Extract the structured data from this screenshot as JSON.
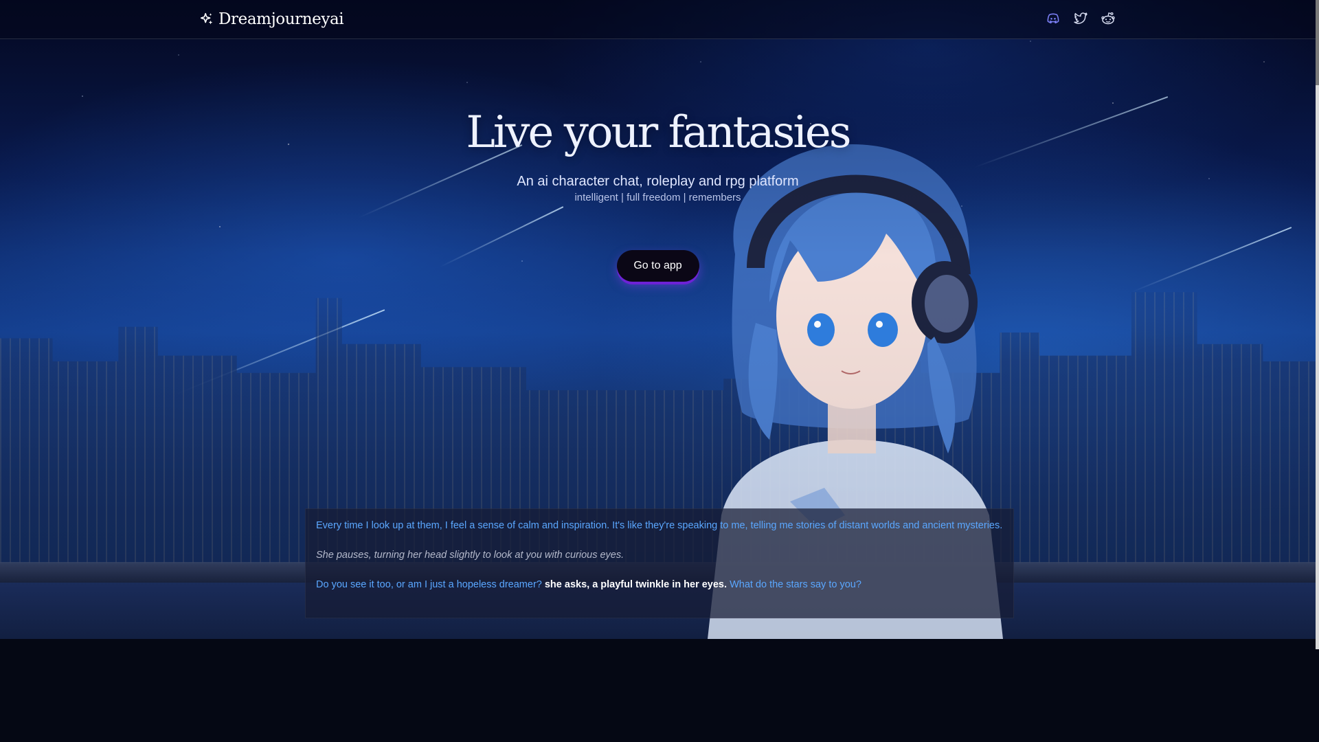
{
  "nav": {
    "brand_name": "Dreamjourneyai",
    "brand_icon": "sparkles-icon",
    "social": [
      {
        "name": "discord-icon",
        "color": "#7b7ff5"
      },
      {
        "name": "twitter-icon",
        "color": "#d6dbef"
      },
      {
        "name": "reddit-icon",
        "color": "#d6dbef"
      }
    ]
  },
  "hero": {
    "headline": "Live your fantasies",
    "subheadline": "An ai character chat, roleplay and rpg platform",
    "tags": "intelligent | full freedom | remembers",
    "cta_label": "Go to app"
  },
  "chat_sample": {
    "line1": "Every time I look up at them, I feel a sense of calm and inspiration. It's like they're speaking to me, telling me stories of distant worlds and ancient mysteries.",
    "line2": "She pauses, turning her head slightly to look at you with curious eyes.",
    "line3_speech_a": "Do you see it too, or am I just a hopeless dreamer?",
    "line3_narration": " she asks, a playful twinkle in her eyes. ",
    "line3_speech_b": "What do the stars say to you?"
  },
  "colors": {
    "accent": "#6d22d6",
    "speech": "#5aa7ff",
    "page_bg": "#050814"
  }
}
